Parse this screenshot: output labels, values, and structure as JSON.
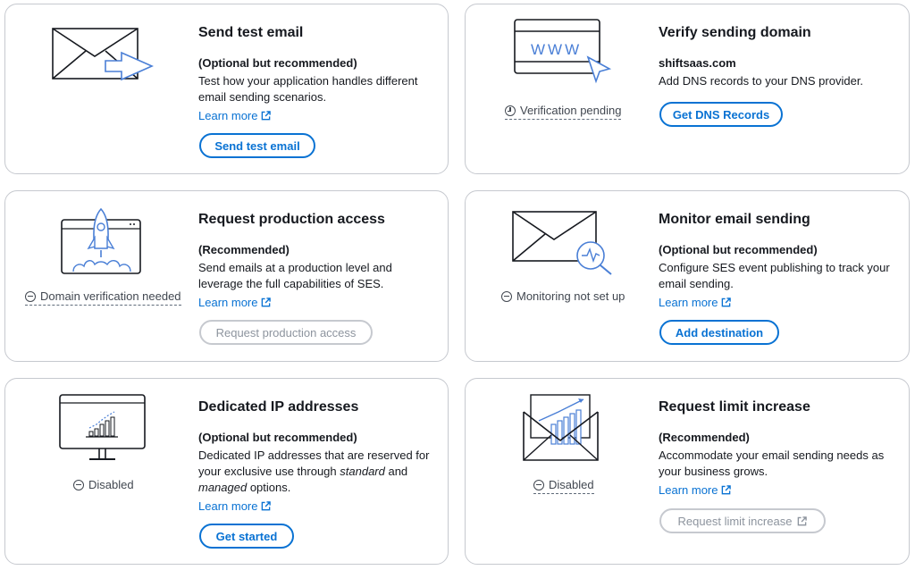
{
  "cards": {
    "test_email": {
      "title": "Send test email",
      "subtitle": "(Optional but recommended)",
      "description": "Test how your application handles different email sending scenarios.",
      "link": "Learn more",
      "button": "Send test email",
      "illustration": "envelope-send-icon"
    },
    "verify_domain": {
      "title": "Verify sending domain",
      "subtitle": "shiftsaas.com",
      "description": "Add DNS records to your DNS provider.",
      "button": "Get DNS Records",
      "status": "Verification pending",
      "illustration_text": "WWW"
    },
    "production": {
      "title": "Request production access",
      "subtitle": "(Recommended)",
      "description": "Send emails at a production level and leverage the full capabilities of SES.",
      "link": "Learn more",
      "button": "Request production access",
      "status": "Domain verification needed"
    },
    "monitor": {
      "title": "Monitor email sending",
      "subtitle": "(Optional but recommended)",
      "description": "Configure SES event publishing to track your email sending.",
      "link": "Learn more",
      "button": "Add destination",
      "status": "Monitoring not set up"
    },
    "dedicated_ip": {
      "title": "Dedicated IP addresses",
      "subtitle": "(Optional but recommended)",
      "description_1": "Dedicated IP addresses that are reserved for your exclusive use through ",
      "description_em1": "standard",
      "description_2": " and ",
      "description_em2": "managed",
      "description_3": " options.",
      "link": "Learn more",
      "button": "Get started",
      "status": "Disabled"
    },
    "limit_increase": {
      "title": "Request limit increase",
      "subtitle": "(Recommended)",
      "description": "Accommodate your email sending needs as your business grows.",
      "link": "Learn more",
      "button": "Request limit increase",
      "status": "Disabled"
    }
  },
  "colors": {
    "accent": "#0972d3",
    "border": "#c6c9cf",
    "disabled": "#8d949e",
    "illustration_accent": "#4a7fd6"
  }
}
